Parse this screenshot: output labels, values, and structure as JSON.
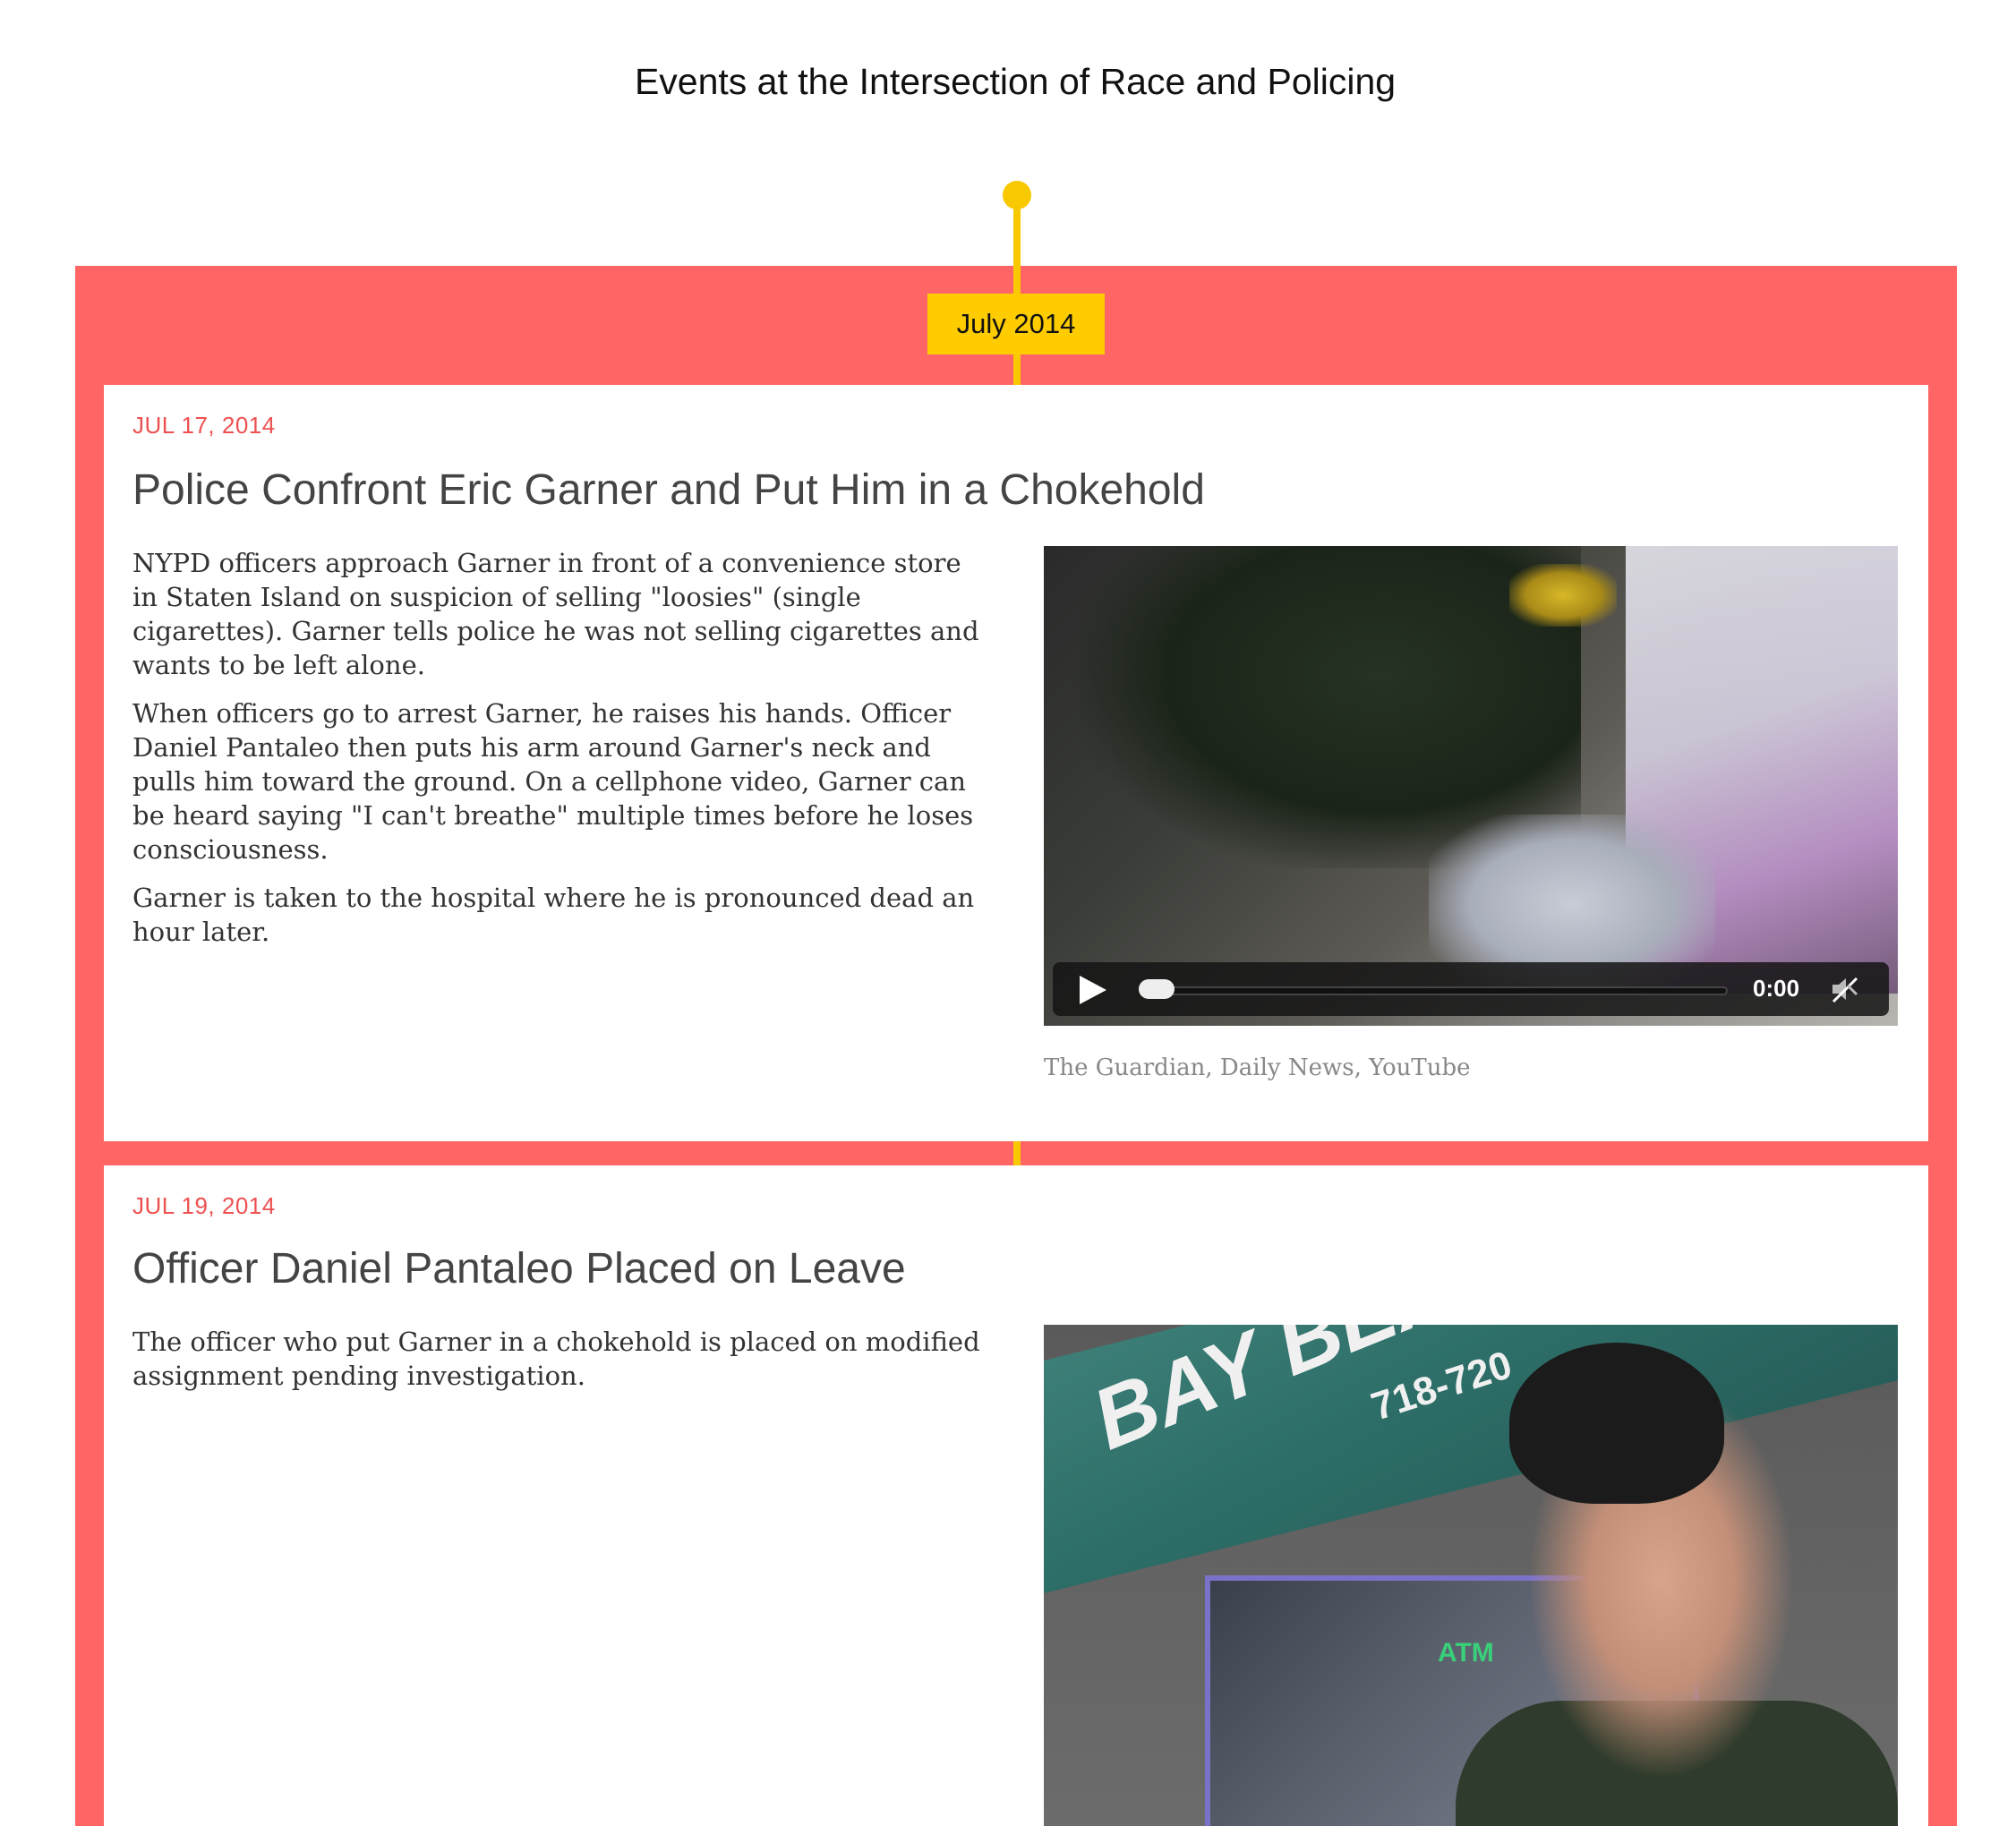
{
  "page": {
    "title": "Events at the Intersection of Race and Policing"
  },
  "timeline": {
    "accent_color": "#ffcc00",
    "band_color": "#ff6565",
    "month_label": "July 2014"
  },
  "events": [
    {
      "date": "JUL 17, 2014",
      "title": "Police Confront Eric Garner and Put Him in a Chokehold",
      "paragraphs": [
        "NYPD officers approach Garner in front of a convenience store in Staten Island on suspicion of selling \"loosies\" (single cigarettes). Garner tells police he was not selling cigarettes and wants to be left alone.",
        "When officers go to arrest Garner, he raises his hands. Officer Daniel Pantaleo then puts his arm around Garner's neck and pulls him toward the ground. On a cellphone video, Garner can be heard saying \"I can't breathe\" multiple times before he loses consciousness.",
        "Garner is taken to the hospital where he is pronounced dead an hour later."
      ],
      "media": {
        "type": "video",
        "time": "0:00",
        "progress": 0,
        "muted": true,
        "icons": [
          "play-icon",
          "mute-icon"
        ],
        "credit": "The Guardian, Daily News, YouTube"
      }
    },
    {
      "date": "JUL 19, 2014",
      "title": "Officer Daniel Pantaleo Placed on Leave",
      "paragraphs": [
        "The officer who put Garner in a chokehold is placed on modified assignment pending investigation."
      ],
      "media": {
        "type": "image",
        "scene_text": {
          "awning": "BAY BEA",
          "phone": "718-720",
          "sign": "ATM"
        }
      }
    }
  ]
}
